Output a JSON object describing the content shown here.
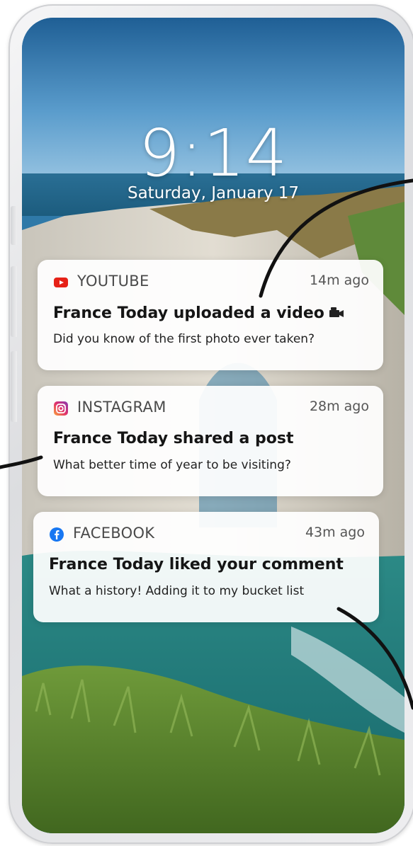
{
  "lock_screen": {
    "time": "9:14",
    "date": "Saturday, January 17"
  },
  "notifications": [
    {
      "app": "YOUTUBE",
      "icon": "youtube-icon",
      "age": "14m ago",
      "title": "France Today uploaded a video",
      "title_icon": "camera-icon",
      "body": "Did you know of the first photo ever taken?"
    },
    {
      "app": "INSTAGRAM",
      "icon": "instagram-icon",
      "age": "28m ago",
      "title": "France Today shared a post",
      "body": "What better time of year to be visiting?"
    },
    {
      "app": "FACEBOOK",
      "icon": "facebook-icon",
      "age": "43m ago",
      "title": "France Today liked your comment",
      "body": "What a history! Adding it to my bucket list"
    }
  ],
  "colors": {
    "youtube": "#e62117",
    "instagram": "#c13584",
    "facebook": "#1877f2",
    "card_bg": "#ffffff",
    "callout_line": "#111111"
  }
}
